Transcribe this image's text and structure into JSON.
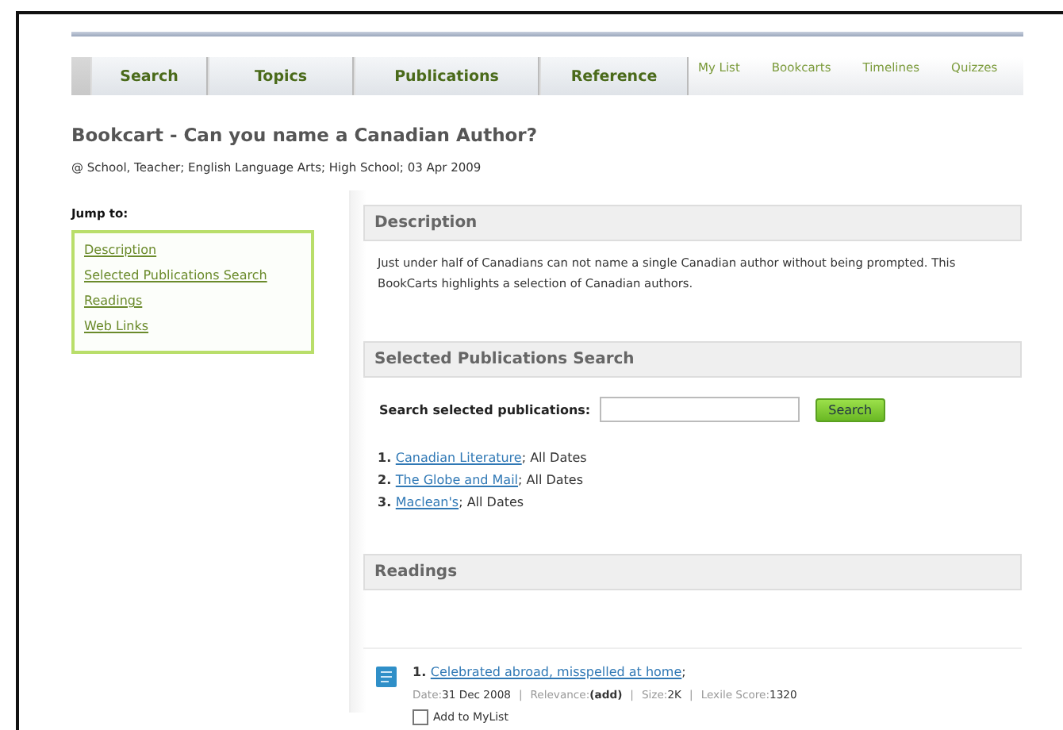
{
  "nav": {
    "tabs": [
      {
        "label": "Search",
        "selected": false
      },
      {
        "label": "Topics",
        "selected": false
      },
      {
        "label": "Publications",
        "selected": false
      },
      {
        "label": "Reference",
        "selected": false
      }
    ],
    "links": [
      "My List",
      "Bookcarts",
      "Timelines",
      "Quizzes"
    ]
  },
  "title": "Bookcart - Can you name a Canadian Author?",
  "subtitle": "@ School, Teacher; English Language Arts; High School; 03 Apr 2009",
  "sidebar": {
    "heading": "Jump to:",
    "items": [
      "Description",
      "Selected Publications Search",
      "Readings",
      "Web Links"
    ]
  },
  "description": {
    "heading": "Description",
    "text": "Just under half of Canadians can not name a single Canadian author without being prompted. This BookCarts highlights a selection of Canadian authors."
  },
  "publication_search": {
    "heading": "Selected Publications Search",
    "label": "Search selected publications:",
    "button": "Search",
    "publications": [
      {
        "number": "1.",
        "name": "Canadian Literature",
        "suffix": "; All Dates"
      },
      {
        "number": "2.",
        "name": "The Globe and Mail",
        "suffix": "; All Dates"
      },
      {
        "number": "3.",
        "name": "Maclean's",
        "suffix": "; All Dates"
      }
    ]
  },
  "readings": {
    "heading": "Readings",
    "items": [
      {
        "number": "1.",
        "title": "Celebrated abroad, misspelled at home",
        "suffix": ";",
        "separator": "|",
        "meta": [
          {
            "label": "Date:",
            "value": "31 Dec 2008",
            "bold": false
          },
          {
            "label": "Relevance:",
            "value": "(add)",
            "bold": true
          },
          {
            "label": "Size:",
            "value": "2K",
            "bold": false
          },
          {
            "label": "Lexile Score:",
            "value": "1320",
            "bold": false
          }
        ],
        "mylist": {
          "label": "Add to MyList",
          "checked": false
        }
      }
    ]
  }
}
